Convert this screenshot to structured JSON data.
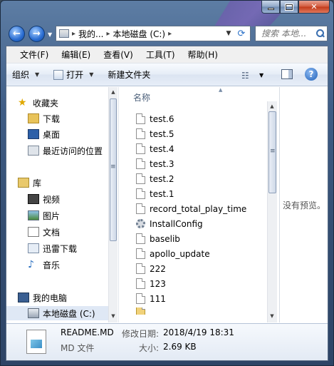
{
  "address": {
    "crumbs": [
      "我的...",
      "本地磁盘 (C:)"
    ]
  },
  "search": {
    "placeholder": "搜索 本地..."
  },
  "menubar": [
    "文件(F)",
    "编辑(E)",
    "查看(V)",
    "工具(T)",
    "帮助(H)"
  ],
  "toolbar": {
    "organize": "组织",
    "open": "打开",
    "new_folder": "新建文件夹"
  },
  "navpane": {
    "favorites": "收藏夹",
    "downloads": "下载",
    "desktop": "桌面",
    "recent": "最近访问的位置",
    "library": "库",
    "videos": "视频",
    "pictures": "图片",
    "documents": "文档",
    "xunlei": "迅雷下载",
    "music": "音乐",
    "computer": "我的电脑",
    "local_disk": "本地磁盘 (C:)"
  },
  "filelist": {
    "column_name": "名称",
    "items": [
      {
        "name": "test.6",
        "icon": "document-icon"
      },
      {
        "name": "test.5",
        "icon": "document-icon"
      },
      {
        "name": "test.4",
        "icon": "document-icon"
      },
      {
        "name": "test.3",
        "icon": "document-icon"
      },
      {
        "name": "test.2",
        "icon": "document-icon"
      },
      {
        "name": "test.1",
        "icon": "document-icon"
      },
      {
        "name": "record_total_play_time",
        "icon": "document-icon"
      },
      {
        "name": "InstallConfig",
        "icon": "settings-file-icon"
      },
      {
        "name": "baselib",
        "icon": "document-icon"
      },
      {
        "name": "apollo_update",
        "icon": "document-icon"
      },
      {
        "name": "222",
        "icon": "document-icon"
      },
      {
        "name": "123",
        "icon": "document-icon"
      },
      {
        "name": "111",
        "icon": "document-icon"
      }
    ]
  },
  "preview": {
    "empty_text": "没有预览。"
  },
  "details": {
    "name": "README.MD",
    "type": "MD 文件",
    "modified_label": "修改日期:",
    "modified_value": "2018/4/19 18:31",
    "size_label": "大小:",
    "size_value": "2.69 KB"
  },
  "colors": {
    "frame": "#3f5d86",
    "accent": "#1e5fb8",
    "close": "#c23a1a",
    "selection": "#dfe8f5"
  }
}
